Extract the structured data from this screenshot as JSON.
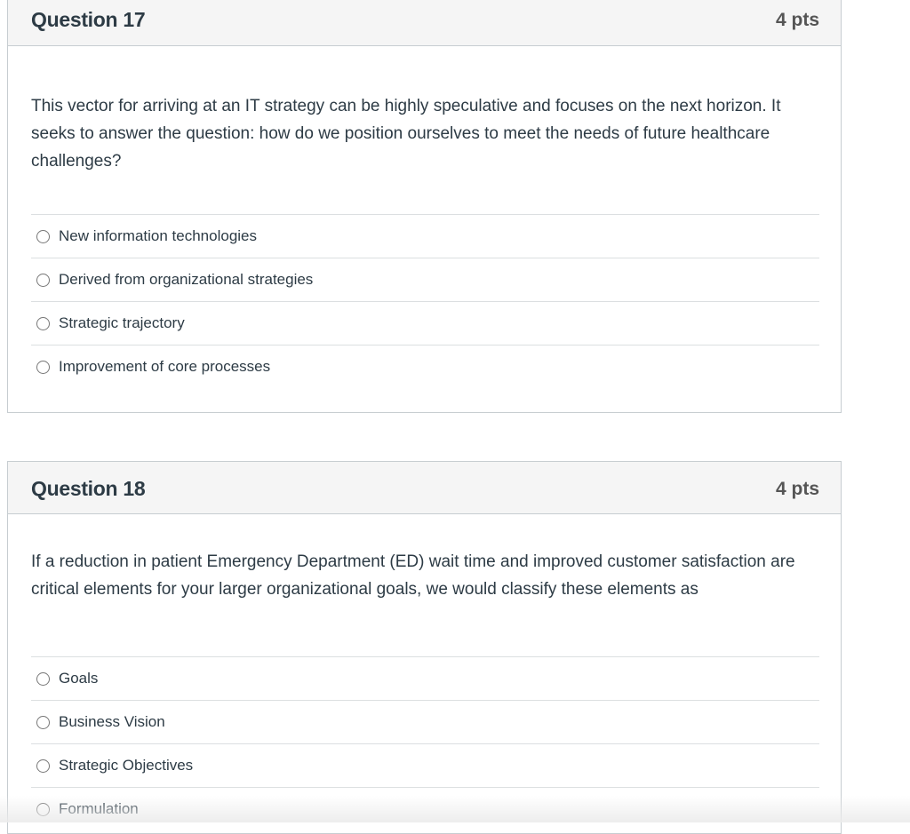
{
  "questions": [
    {
      "title": "Question 17",
      "points": "4 pts",
      "text": "This vector for arriving at an IT strategy can be highly speculative and focuses on the next horizon. It seeks to answer the question: how do we position ourselves to meet the needs of future healthcare challenges?",
      "answers": [
        "New information technologies",
        "Derived from organizational strategies",
        "Strategic trajectory",
        "Improvement of core processes"
      ]
    },
    {
      "title": "Question 18",
      "points": "4 pts",
      "text": "If a reduction in patient Emergency Department (ED) wait time and improved customer satisfaction are critical elements for your larger organizational goals, we would classify these elements as",
      "answers": [
        "Goals",
        "Business Vision",
        "Strategic Objectives",
        "Formulation"
      ]
    }
  ]
}
